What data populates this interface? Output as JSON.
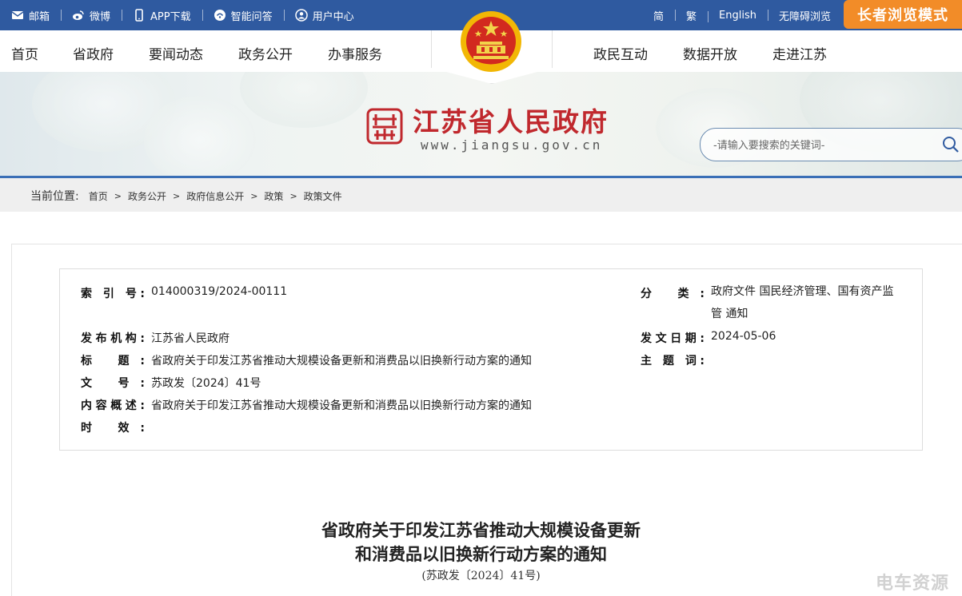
{
  "topbar": {
    "items": [
      {
        "label": "邮箱",
        "icon": "mail-icon"
      },
      {
        "label": "微博",
        "icon": "weibo-icon"
      },
      {
        "label": "APP下载",
        "icon": "phone-icon"
      },
      {
        "label": "智能问答",
        "icon": "chat-icon"
      },
      {
        "label": "用户中心",
        "icon": "user-icon"
      }
    ],
    "right": [
      "简",
      "繁",
      "English",
      "无障碍浏览"
    ],
    "elder_mode": "长者浏览模式"
  },
  "nav": {
    "left": [
      "首页",
      "省政府",
      "要闻动态",
      "政务公开",
      "办事服务"
    ],
    "right": [
      "政民互动",
      "数据开放",
      "走进江苏"
    ]
  },
  "banner": {
    "site_name": "江苏省人民政府",
    "site_url": "www.jiangsu.gov.cn",
    "search_placeholder": "-请输入要搜索的关键词-"
  },
  "breadcrumb": {
    "label": "当前位置:",
    "items": [
      "首页",
      "政务公开",
      "政府信息公开",
      "政策",
      "政策文件"
    ],
    "sep": ">"
  },
  "meta": {
    "index_label": "索 引 号:",
    "index_value": "014000319/2024-00111",
    "category_label": "分 类:",
    "category_value_1": "政府文件 国民经济管理、国有资产监",
    "category_value_2": "管 通知",
    "publisher_label": "发布机构:",
    "publisher_value": "江苏省人民政府",
    "date_label": "发文日期:",
    "date_value": "2024-05-06",
    "title_label": "标 题:",
    "title_value": "省政府关于印发江苏省推动大规模设备更新和消费品以旧换新行动方案的通知",
    "subject_label": "主 题 词:",
    "subject_value": "",
    "docno_label": "文 号:",
    "docno_value": "苏政发〔2024〕41号",
    "summary_label": "内容概述:",
    "summary_value": "省政府关于印发江苏省推动大规模设备更新和消费品以旧换新行动方案的通知",
    "validity_label": "时 效:",
    "validity_value": ""
  },
  "document": {
    "title_line1": "省政府关于印发江苏省推动大规模设备更新",
    "title_line2": "和消费品以旧换新行动方案的通知",
    "doc_number": "(苏政发〔2024〕41号)"
  },
  "watermark": "电车资源",
  "colors": {
    "topbar": "#2f5aa0",
    "elder": "#f28c28",
    "brand_red": "#c0282d",
    "accent_blue": "#3a6fb6"
  }
}
